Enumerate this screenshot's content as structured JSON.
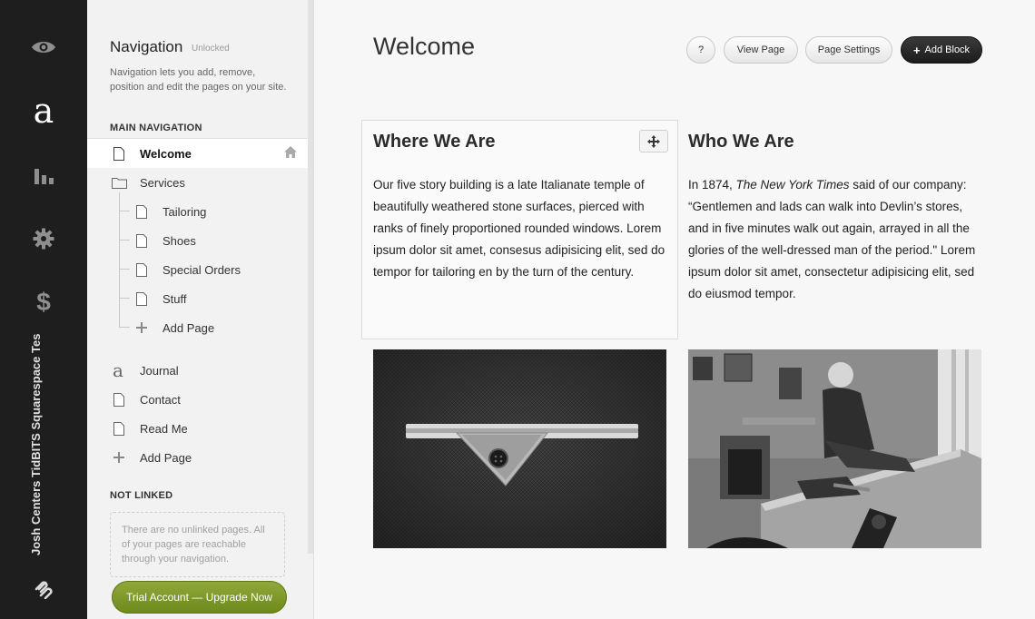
{
  "rail": {
    "site_name": "Josh Centers TidBITS Squarespace Tes",
    "icons": [
      "eye-icon",
      "squarespace-a-icon",
      "stats-icon",
      "gear-icon",
      "dollar-icon",
      "squarespace-logo-icon"
    ]
  },
  "panel": {
    "title": "Navigation",
    "status": "Unlocked",
    "description": "Navigation lets you add, remove, position and edit the pages on your site.",
    "main_nav_label": "MAIN NAVIGATION",
    "main_items": [
      {
        "label": "Welcome",
        "icon": "page-icon",
        "selected": true
      },
      {
        "label": "Services",
        "icon": "folder-icon"
      },
      {
        "label": "Tailoring",
        "icon": "page-icon"
      },
      {
        "label": "Shoes",
        "icon": "page-icon"
      },
      {
        "label": "Special Orders",
        "icon": "page-icon"
      },
      {
        "label": "Stuff",
        "icon": "page-icon"
      },
      {
        "label": "Add Page",
        "icon": "plus-icon"
      },
      {
        "label": "Journal",
        "icon": "blog-icon"
      },
      {
        "label": "Contact",
        "icon": "page-icon"
      },
      {
        "label": "Read Me",
        "icon": "page-icon"
      },
      {
        "label": "Add Page",
        "icon": "plus-icon"
      }
    ],
    "not_linked_label": "NOT LINKED",
    "not_linked_text": "There are no unlinked pages. All of your pages are reachable through your navigation.",
    "upgrade_label": "Trial Account — Upgrade Now"
  },
  "main": {
    "title": "Welcome",
    "buttons": {
      "help": "?",
      "view_page": "View Page",
      "page_settings": "Page Settings",
      "add_block": "Add Block"
    },
    "left": {
      "title": "Where We Are",
      "text": "Our five story building is a late Italianate temple of beautifully weathered stone surfaces, pierced with ranks of finely proportioned rounded windows. Lorem ipsum dolor sit amet, consesus adipisicing elit, sed do tempor for tailoring en by the turn of the century."
    },
    "right": {
      "title": "Who We Are",
      "text_before": "In 1874, ",
      "text_italic": "The New York Times",
      "text_after": " said of our company: “Gentlemen and lads can walk into Devlin’s stores, and in five minutes walk out again, arrayed in all the glories of the well-dressed man of the period.\" Lorem ipsum dolor sit amet, consectetur adipisicing elit, sed do eiusmod tempor."
    },
    "colors": {
      "rail_bg": "#1e1e1e",
      "upgrade_green": "#7a9426",
      "add_block_bg": "#222222"
    }
  }
}
